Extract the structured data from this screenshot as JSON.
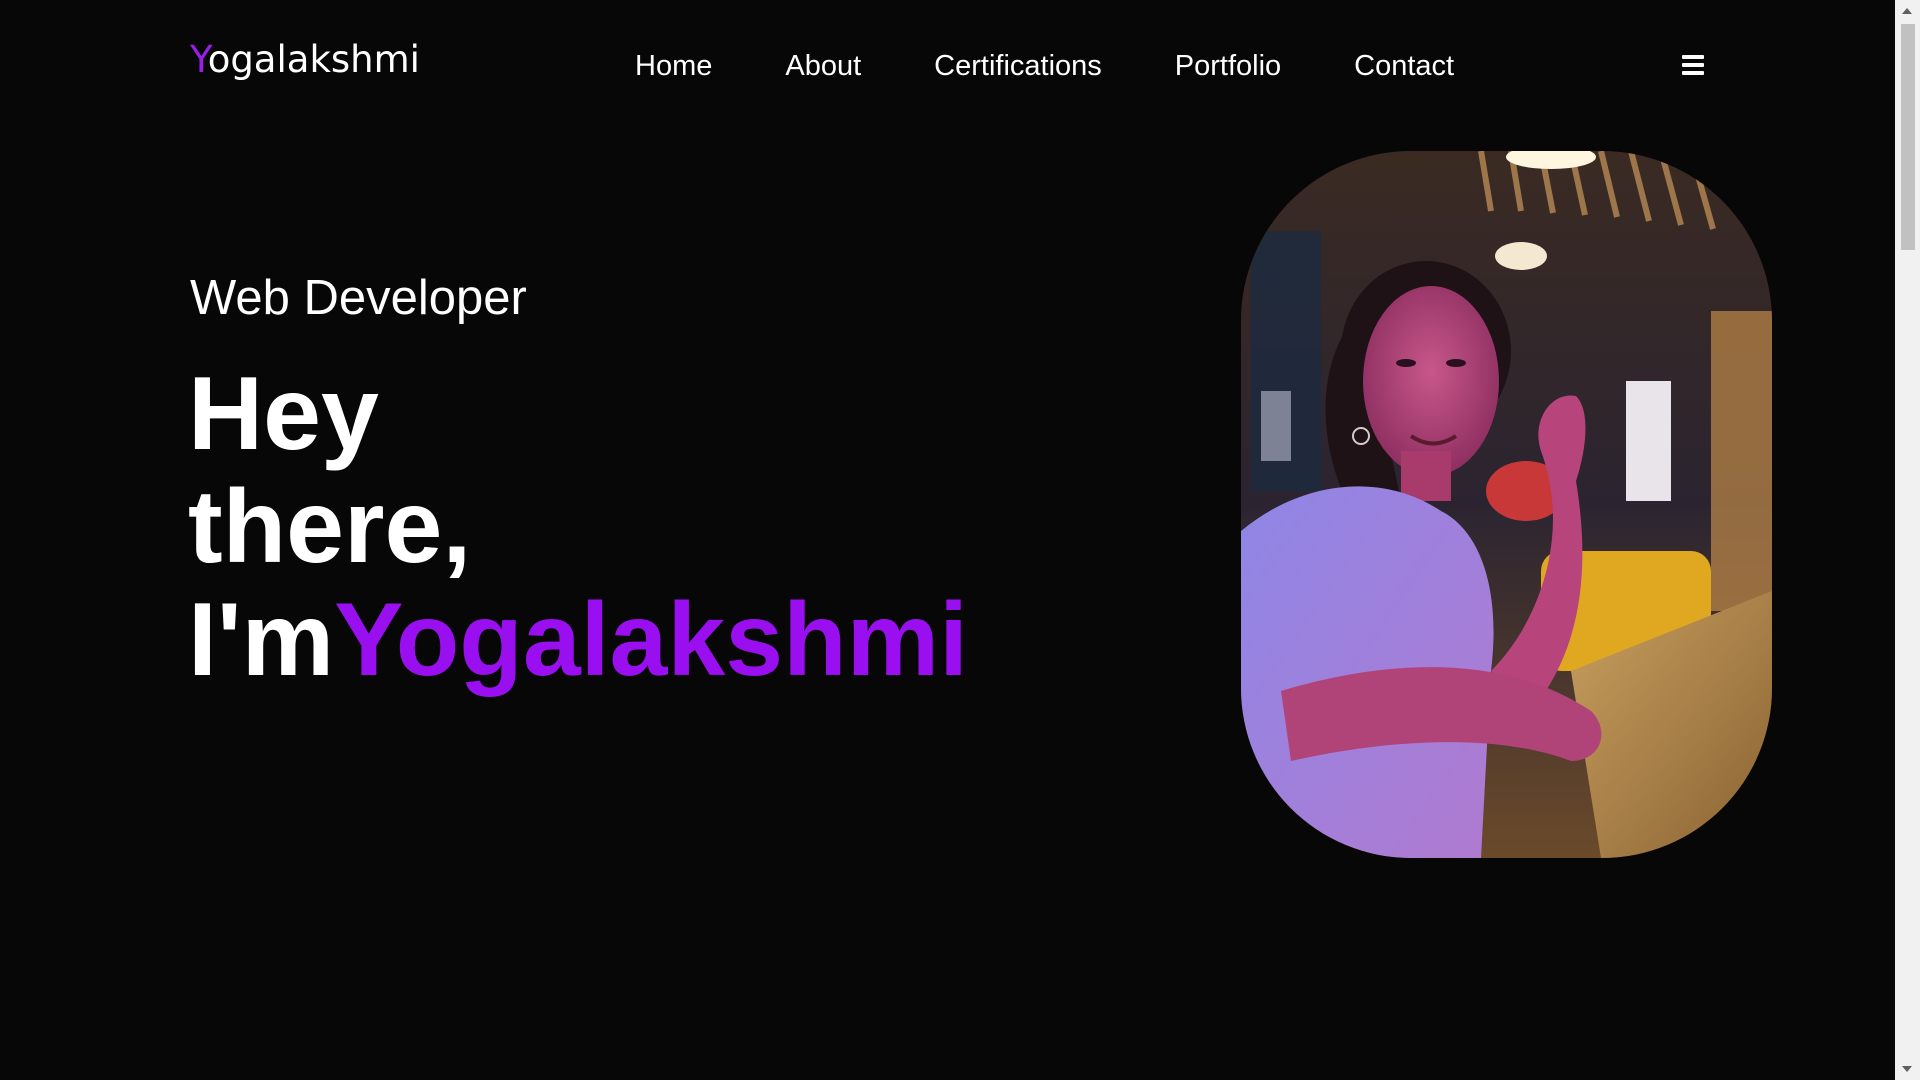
{
  "header": {
    "logo_first_letter": "Y",
    "logo_rest": "ogalakshmi",
    "nav": [
      {
        "label": "Home"
      },
      {
        "label": "About"
      },
      {
        "label": "Certifications"
      },
      {
        "label": "Portfolio"
      },
      {
        "label": "Contact"
      }
    ],
    "menu_icon": "hamburger-menu-icon"
  },
  "hero": {
    "subtitle": "Web Developer",
    "line1": "Hey",
    "line2": "there,",
    "line3_prefix": "I'm",
    "name": "Yogalakshmi"
  },
  "colors": {
    "background": "#080708",
    "accent": "#9a0ff0",
    "text": "#ffffff"
  }
}
